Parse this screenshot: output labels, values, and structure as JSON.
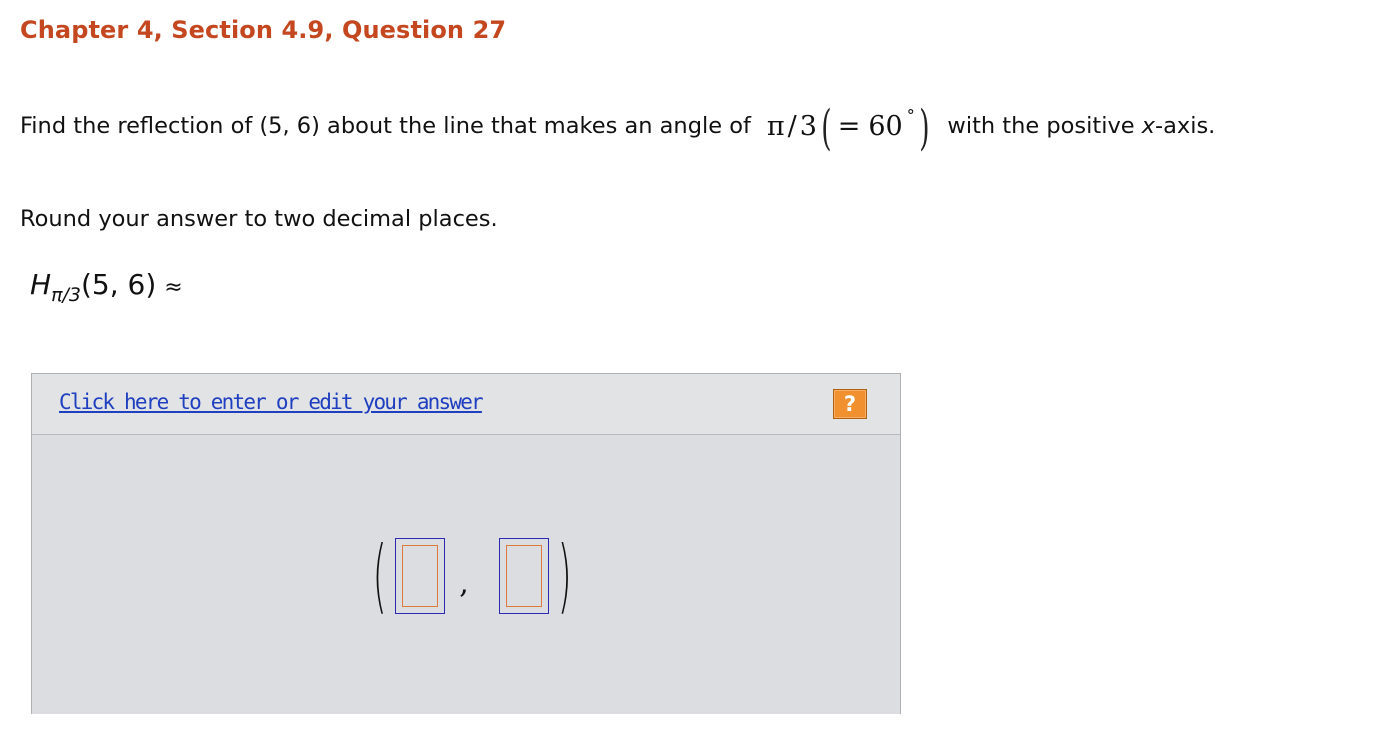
{
  "header": {
    "title": "Chapter 4, Section 4.9, Question 27"
  },
  "question": {
    "prefix": "Find the reflection of (5, 6) about the line that makes an angle of",
    "angle_pi": "π",
    "angle_slash": "/",
    "angle_den": "3",
    "angle_equals": "=",
    "angle_deg_value": "60",
    "angle_deg_symbol": "°",
    "suffix_before_var": "with the positive",
    "var": "x",
    "suffix_after_var": "-axis."
  },
  "instruction": "Round your answer to two decimal places.",
  "formula": {
    "operator": "H",
    "subscript": "π/3",
    "argument": "(5, 6)",
    "approx": "≈"
  },
  "answer_panel": {
    "edit_link": "Click here to enter or edit your answer",
    "help_label": "?",
    "open_paren": "(",
    "comma": ",",
    "close_paren": ")",
    "inputs": [
      {
        "value": ""
      },
      {
        "value": ""
      }
    ]
  }
}
